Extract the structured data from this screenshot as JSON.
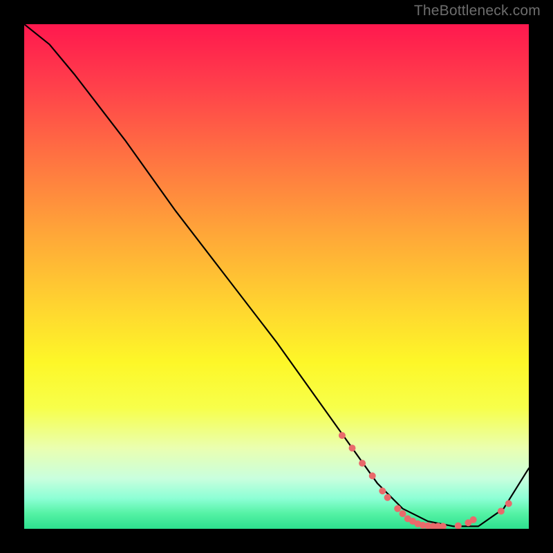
{
  "watermark": "TheBottleneck.com",
  "chart_data": {
    "type": "line",
    "title": "",
    "xlabel": "",
    "ylabel": "",
    "xlim": [
      0,
      1
    ],
    "ylim": [
      0,
      1
    ],
    "series": [
      {
        "name": "curve",
        "x": [
          0.0,
          0.05,
          0.1,
          0.2,
          0.3,
          0.4,
          0.5,
          0.6,
          0.65,
          0.7,
          0.75,
          0.8,
          0.85,
          0.9,
          0.95,
          1.0
        ],
        "y": [
          1.0,
          0.96,
          0.9,
          0.77,
          0.63,
          0.5,
          0.37,
          0.23,
          0.16,
          0.09,
          0.04,
          0.015,
          0.005,
          0.005,
          0.04,
          0.12
        ],
        "color": "#000000"
      }
    ],
    "markers": {
      "name": "highlight-dots",
      "x": [
        0.63,
        0.65,
        0.67,
        0.69,
        0.71,
        0.72,
        0.74,
        0.75,
        0.76,
        0.77,
        0.78,
        0.79,
        0.8,
        0.81,
        0.82,
        0.83,
        0.86,
        0.88,
        0.89,
        0.945,
        0.96
      ],
      "y": [
        0.185,
        0.16,
        0.13,
        0.105,
        0.075,
        0.062,
        0.04,
        0.03,
        0.02,
        0.015,
        0.01,
        0.007,
        0.006,
        0.005,
        0.005,
        0.005,
        0.006,
        0.012,
        0.018,
        0.035,
        0.05
      ],
      "color": "#e96a6b",
      "radius": 5
    },
    "background": {
      "type": "vertical-gradient",
      "stops": [
        {
          "pos": 0.0,
          "color": "#ff184e"
        },
        {
          "pos": 0.26,
          "color": "#ff7142"
        },
        {
          "pos": 0.57,
          "color": "#ffd82f"
        },
        {
          "pos": 0.76,
          "color": "#f7ff4a"
        },
        {
          "pos": 0.94,
          "color": "#8cffd5"
        },
        {
          "pos": 1.0,
          "color": "#2de08f"
        }
      ]
    }
  }
}
